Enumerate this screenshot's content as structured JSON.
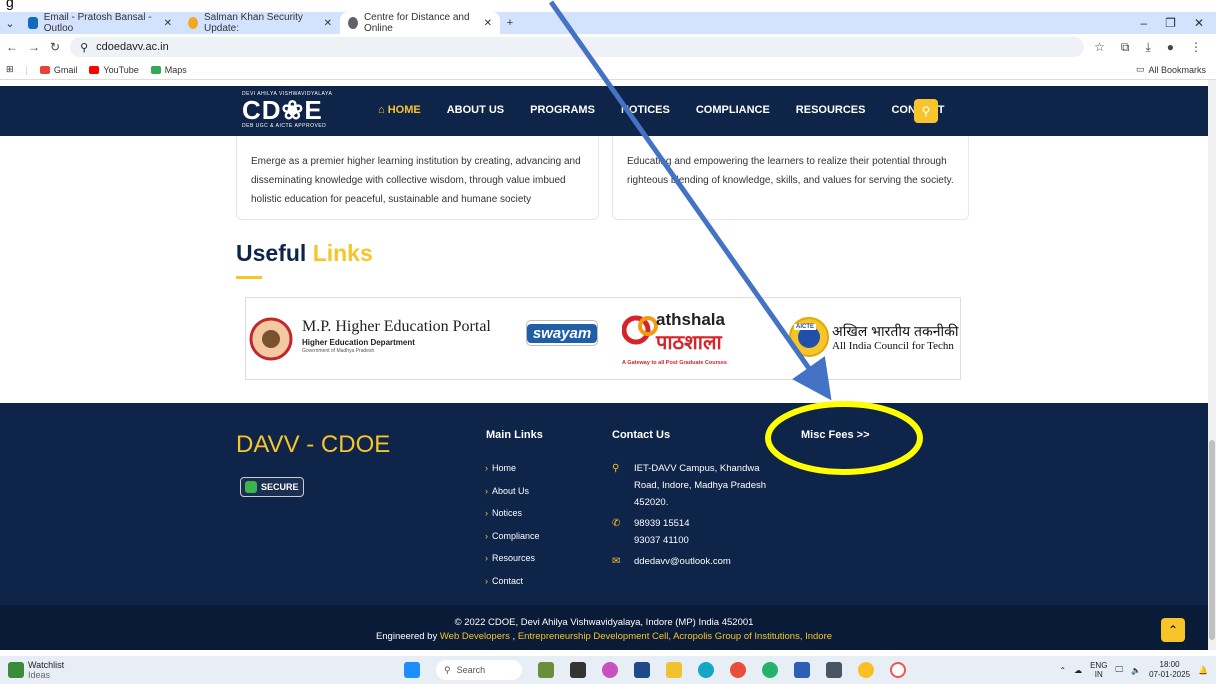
{
  "page_top_text": "g",
  "browser": {
    "tabs": [
      {
        "label": "Email - Pratosh Bansal - Outloo",
        "color": "#0f6cbd"
      },
      {
        "label": "Salman Khan Security Update: ",
        "color": "#f5a623"
      },
      {
        "label": "Centre for Distance and Online",
        "color": "#5f6368"
      }
    ],
    "url": "cdoedavv.ac.in",
    "bookmarks": [
      {
        "label": "Gmail",
        "color": "#ea4335"
      },
      {
        "label": "YouTube",
        "color": "#ff0000"
      },
      {
        "label": "Maps",
        "color": "#34a853"
      }
    ],
    "all_bookmarks": "All Bookmarks"
  },
  "navbar": {
    "logo_top": "DEVI AHILYA VISHWAVIDYALAYA",
    "logo_main": "CD❀E",
    "logo_bottom": "DEB UGC & AICTE APPROVED",
    "items": [
      "HOME",
      "ABOUT US",
      "PROGRAMS",
      "NOTICES",
      "COMPLIANCE",
      "RESOURCES",
      "CONTACT"
    ]
  },
  "vision_text": "Emerge as a premier higher learning institution by creating, advancing and disseminating knowledge with collective wisdom, through value imbued holistic education for peaceful, sustainable and humane society",
  "mission_text": "Educating and empowering the learners to realize their potential through righteous blending of knowledge, skills, and values for serving the society.",
  "useful_links": {
    "title_a": "Useful",
    "title_b": "Links",
    "mp_portal": "M.P. Higher Education Portal",
    "mp_sub": "Higher Education Department",
    "mp_sub2": "Government of Madhya Pradesh",
    "swayam": "swayam",
    "pathshala_a": "athshala",
    "pathshala_b": "पाठशाला",
    "pathshala_sub": "A Gateway to all Post Graduate Courses",
    "aicte_a": "अखिल भारतीय तकनीकी",
    "aicte_b": "All India Council for Techn",
    "aicte_badge": "AICTE"
  },
  "footer": {
    "brand": "DAVV - CDOE",
    "secure": "SECURE",
    "main_links_title": "Main Links",
    "main_links": [
      "Home",
      "About Us",
      "Notices",
      "Compliance",
      "Resources",
      "Contact"
    ],
    "contact_title": "Contact Us",
    "address": "IET-DAVV Campus, Khandwa Road, Indore, Madhya Pradesh 452020.",
    "phone1": "98939 15514",
    "phone2": "93037 41100",
    "email": "ddedavv@outlook.com",
    "misc_fees": "Misc Fees >>"
  },
  "copyright": {
    "line1": "© 2022 CDOE, Devi Ahilya Vishwavidyalaya, Indore (MP) India 452001",
    "engineered_by": "Engineered by ",
    "web_devs": "Web Developers",
    "comma": " , ",
    "edc": "Entrepreneurship Development Cell, Acropolis Group of Institutions, Indore"
  },
  "taskbar": {
    "watchlist": "Watchlist",
    "ideas": "Ideas",
    "search": "Search",
    "lang": "ENG",
    "region": "IN",
    "time": "18:00",
    "date": "07-01-2025"
  }
}
